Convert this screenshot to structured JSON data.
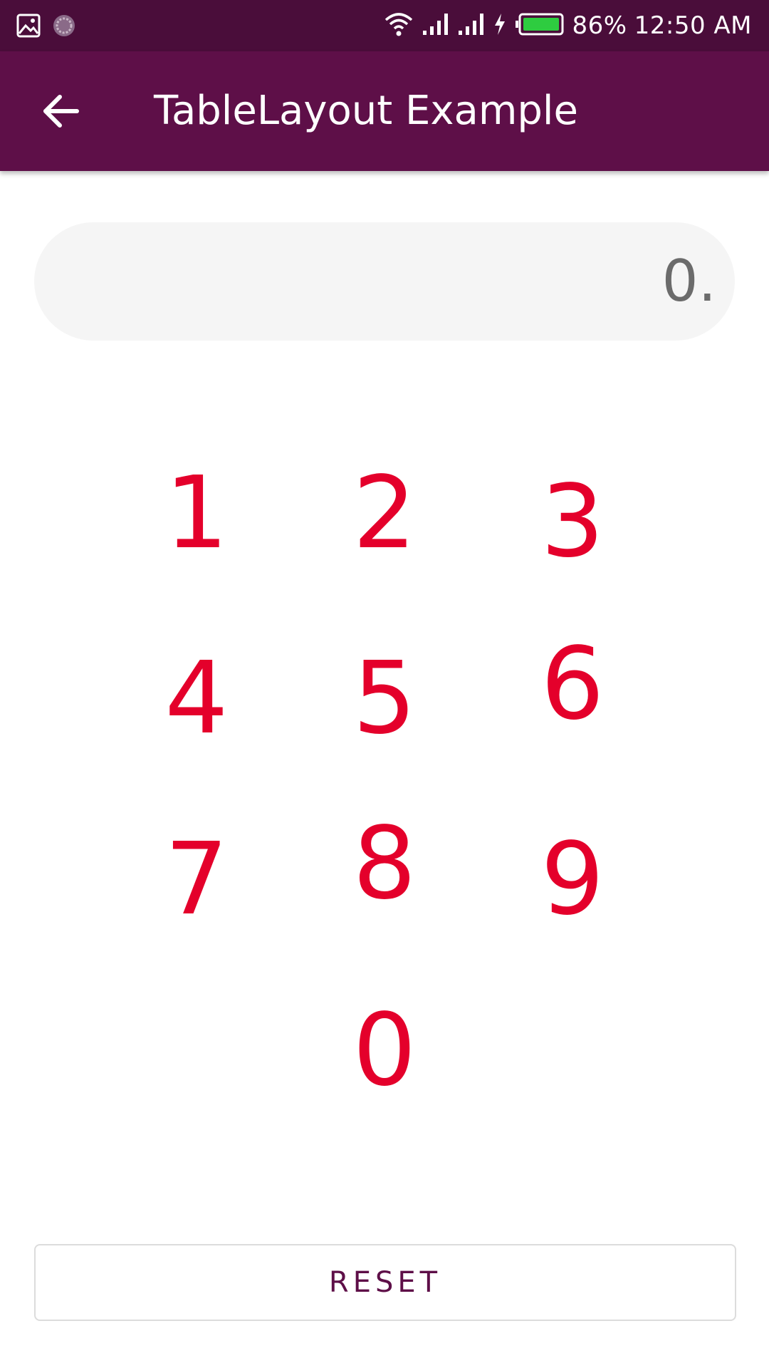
{
  "status_bar": {
    "battery": "86%",
    "time": "12:50 AM",
    "icons": [
      "gallery-icon",
      "sync-icon",
      "wifi-icon",
      "signal-icon",
      "signal-icon",
      "charging-icon",
      "battery-icon"
    ]
  },
  "app_bar": {
    "title": "TableLayout Example",
    "back_icon": "arrow-left-icon"
  },
  "display": {
    "value": "0."
  },
  "keypad": {
    "keys": [
      "1",
      "2",
      "3",
      "4",
      "5",
      "6",
      "7",
      "8",
      "9",
      "0"
    ]
  },
  "reset_button": {
    "label": "RESET"
  },
  "colors": {
    "status_bar": "#4a0d3a",
    "app_bar": "#5e0f48",
    "key_text": "#e4002b",
    "display_bg": "#f5f5f5",
    "display_text": "#6b6b6b",
    "reset_text": "#5e0f48"
  }
}
